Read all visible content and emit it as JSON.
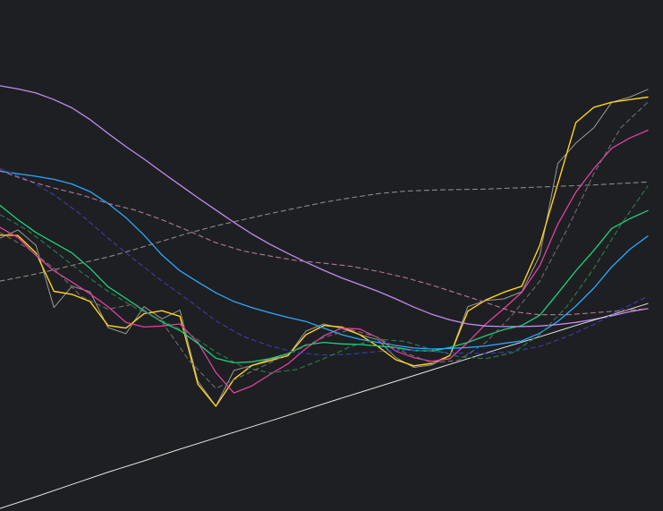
{
  "chart_data": {
    "type": "line",
    "title": "",
    "xlabel": "",
    "ylabel": "",
    "grid": false,
    "legend": "none",
    "xlim": [
      0,
      72
    ],
    "ylim": [
      0,
      100
    ],
    "background": "#1e1f22",
    "series": [
      {
        "color": "#9a9a9a",
        "dash": false,
        "width": 1,
        "x": [
          0,
          2,
          4,
          6,
          8,
          10,
          12,
          14,
          16,
          18,
          20,
          22,
          24,
          26,
          28,
          30,
          32,
          34,
          36,
          38,
          40,
          42,
          44,
          46,
          48,
          50,
          52,
          54,
          56,
          58,
          60,
          62,
          64,
          66,
          68,
          70,
          72
        ],
        "values": [
          53.4,
          55.0,
          52.0,
          39.8,
          44.0,
          42.9,
          35.9,
          34.7,
          40.0,
          37.6,
          39.3,
          25.4,
          20.5,
          27.5,
          28.5,
          29.7,
          30.4,
          35.2,
          36.6,
          35.7,
          34.5,
          33.5,
          30.0,
          28.1,
          28.6,
          30.4,
          40.0,
          41.2,
          41.5,
          42.9,
          50.0,
          68.0,
          72.0,
          75.0,
          80.0,
          81.0,
          82.5
        ]
      },
      {
        "color": "#ffd21f",
        "dash": false,
        "width": 1.4,
        "x": [
          0,
          2,
          4,
          6,
          8,
          10,
          12,
          14,
          16,
          18,
          20,
          22,
          24,
          26,
          28,
          30,
          32,
          34,
          36,
          38,
          40,
          42,
          44,
          46,
          48,
          50,
          52,
          54,
          56,
          58,
          60,
          62,
          64,
          66,
          68,
          70,
          72
        ],
        "values": [
          54.0,
          53.9,
          50.5,
          43.0,
          42.4,
          41.0,
          36.3,
          35.8,
          38.6,
          39.2,
          38.1,
          24.8,
          20.5,
          25.8,
          28.5,
          29.4,
          30.4,
          34.5,
          36.3,
          36.0,
          34.5,
          32.2,
          29.6,
          28.4,
          28.9,
          30.4,
          39.1,
          41.3,
          42.8,
          44.0,
          52.0,
          64.0,
          76.0,
          79.0,
          80.0,
          80.5,
          81.0
        ]
      },
      {
        "color": "#e040a0",
        "dash": false,
        "width": 1.3,
        "x": [
          0,
          2,
          4,
          6,
          8,
          10,
          12,
          14,
          16,
          18,
          20,
          22,
          24,
          26,
          28,
          30,
          32,
          34,
          36,
          38,
          40,
          42,
          44,
          46,
          48,
          50,
          52,
          54,
          56,
          58,
          60,
          62,
          64,
          66,
          68,
          70,
          72
        ],
        "values": [
          55.5,
          53.5,
          50.0,
          47.0,
          44.8,
          42.5,
          40.0,
          36.9,
          36.0,
          36.2,
          36.6,
          33.0,
          27.1,
          23.1,
          24.5,
          26.7,
          28.8,
          31.8,
          34.3,
          35.8,
          35.6,
          33.9,
          31.3,
          30.0,
          29.3,
          29.8,
          33.0,
          36.6,
          39.6,
          42.8,
          48.0,
          56.1,
          62.4,
          67.0,
          71.0,
          73.0,
          74.5
        ]
      },
      {
        "color": "#20d07a",
        "dash": false,
        "width": 1.3,
        "x": [
          0,
          2,
          4,
          6,
          8,
          10,
          12,
          14,
          16,
          18,
          20,
          22,
          24,
          26,
          28,
          30,
          32,
          34,
          36,
          38,
          40,
          42,
          44,
          46,
          48,
          50,
          52,
          54,
          56,
          58,
          60,
          62,
          64,
          66,
          68,
          70,
          72
        ],
        "values": [
          59.8,
          57.0,
          54.5,
          52.5,
          50.5,
          47.5,
          43.9,
          41.6,
          39.2,
          37.0,
          35.3,
          32.8,
          29.9,
          29.0,
          29.2,
          29.8,
          30.8,
          32.5,
          33.0,
          32.7,
          32.6,
          32.3,
          32.0,
          31.4,
          31.3,
          32.0,
          33.0,
          34.3,
          35.5,
          36.3,
          38.3,
          42.6,
          47.0,
          51.0,
          55.3,
          57.2,
          58.8
        ]
      },
      {
        "color": "#2aa8ff",
        "dash": false,
        "width": 1.3,
        "x": [
          0,
          2,
          4,
          6,
          8,
          10,
          12,
          14,
          16,
          18,
          20,
          22,
          24,
          26,
          28,
          30,
          32,
          34,
          36,
          38,
          40,
          42,
          44,
          46,
          48,
          50,
          52,
          54,
          56,
          58,
          60,
          62,
          64,
          66,
          68,
          70,
          72
        ],
        "values": [
          66.5,
          66.0,
          65.5,
          64.9,
          64.0,
          62.5,
          60.2,
          57.4,
          54.0,
          50.1,
          47.0,
          44.8,
          42.7,
          41.0,
          39.8,
          38.8,
          37.9,
          37.1,
          35.8,
          34.5,
          33.6,
          33.0,
          32.4,
          31.9,
          31.7,
          31.8,
          32.0,
          32.3,
          32.8,
          33.3,
          34.8,
          37.1,
          40.1,
          43.6,
          47.8,
          51.2,
          53.8
        ]
      },
      {
        "color": "#c38bf0",
        "dash": false,
        "width": 1.3,
        "x": [
          0,
          2,
          4,
          6,
          8,
          10,
          12,
          14,
          16,
          18,
          20,
          22,
          24,
          26,
          28,
          30,
          32,
          34,
          36,
          38,
          40,
          42,
          44,
          46,
          48,
          50,
          52,
          54,
          56,
          58,
          60,
          62,
          64,
          66,
          68,
          70,
          72
        ],
        "values": [
          83.2,
          82.6,
          81.8,
          80.5,
          78.9,
          76.6,
          73.9,
          71.3,
          68.9,
          66.3,
          63.8,
          61.3,
          58.9,
          56.5,
          54.2,
          52.2,
          50.4,
          48.7,
          47.1,
          45.6,
          44.3,
          43.0,
          41.5,
          39.9,
          38.5,
          37.4,
          36.6,
          36.2,
          36.1,
          36.1,
          36.2,
          36.5,
          36.9,
          37.5,
          38.2,
          39.0,
          39.6
        ]
      },
      {
        "color": "#e6e6e6",
        "dash": false,
        "width": 1,
        "x": [
          0,
          4,
          8,
          12,
          16,
          20,
          24,
          28,
          32,
          36,
          40,
          44,
          48,
          52,
          56,
          60,
          64,
          68,
          72
        ],
        "values": [
          0.5,
          2.8,
          5.2,
          7.6,
          9.8,
          12.1,
          14.3,
          16.5,
          18.7,
          21.0,
          23.2,
          25.4,
          27.6,
          29.8,
          32.0,
          34.1,
          36.3,
          38.4,
          40.6
        ]
      },
      {
        "color": "#3b3fa8",
        "dash": true,
        "width": 1.1,
        "x": [
          0,
          3,
          6,
          9,
          12,
          15,
          18,
          21,
          24,
          27,
          30,
          33,
          36,
          39,
          42,
          45,
          48,
          51,
          54,
          57,
          60,
          63,
          66,
          69,
          72
        ],
        "values": [
          67.0,
          64.9,
          61.9,
          58.0,
          53.4,
          49.1,
          45.0,
          41.2,
          37.2,
          34.2,
          32.3,
          31.0,
          30.5,
          30.7,
          31.2,
          31.5,
          31.2,
          30.9,
          30.8,
          31.2,
          32.2,
          34.1,
          36.5,
          39.4,
          42.0
        ]
      },
      {
        "color": "#b07a95",
        "dash": true,
        "width": 1.1,
        "x": [
          0,
          3,
          6,
          9,
          12,
          15,
          18,
          21,
          24,
          27,
          30,
          33,
          36,
          39,
          42,
          45,
          48,
          51,
          54,
          57,
          60,
          63,
          66,
          69,
          72
        ],
        "values": [
          66.6,
          64.7,
          63.2,
          61.9,
          60.2,
          58.9,
          57.0,
          54.8,
          52.5,
          50.9,
          49.9,
          49.0,
          48.5,
          47.9,
          46.9,
          45.7,
          44.2,
          42.5,
          40.8,
          39.0,
          38.4,
          38.4,
          38.8,
          39.2,
          39.6
        ]
      },
      {
        "color": "#8a8a8a",
        "dash": true,
        "width": 1.1,
        "x": [
          0,
          3,
          6,
          9,
          12,
          15,
          18,
          21,
          24,
          27,
          30,
          33,
          36,
          39,
          42,
          45,
          48,
          51,
          54,
          57,
          60,
          63,
          66,
          69,
          72
        ],
        "values": [
          45.0,
          46.0,
          47.2,
          48.5,
          49.7,
          51.2,
          52.8,
          54.4,
          55.8,
          57.0,
          58.2,
          59.3,
          60.4,
          61.3,
          62.1,
          62.6,
          62.8,
          62.9,
          63.0,
          63.2,
          63.4,
          63.6,
          63.8,
          64.1,
          64.4
        ]
      },
      {
        "color": "#2e7d4f",
        "dash": true,
        "width": 1.1,
        "x": [
          0,
          3,
          6,
          9,
          12,
          15,
          18,
          21,
          24,
          27,
          30,
          33,
          36,
          39,
          42,
          45,
          48,
          51,
          54,
          57,
          60,
          63,
          66,
          69,
          72
        ],
        "values": [
          58.0,
          55.0,
          51.0,
          46.8,
          43.0,
          39.8,
          37.3,
          34.7,
          31.1,
          28.2,
          27.0,
          27.7,
          29.8,
          32.2,
          33.6,
          33.2,
          31.6,
          30.2,
          29.8,
          31.0,
          34.5,
          40.0,
          47.5,
          56.0,
          63.6
        ]
      },
      {
        "color": "#6e6e6e",
        "dash": true,
        "width": 1.1,
        "x": [
          0,
          3,
          6,
          9,
          12,
          15,
          18,
          21,
          24,
          27,
          30,
          33,
          36,
          39,
          42,
          45,
          48,
          51,
          54,
          57,
          60,
          63,
          66,
          69,
          72
        ],
        "values": [
          54.5,
          51.5,
          47.5,
          42.0,
          39.5,
          40.5,
          37.0,
          29.5,
          24.0,
          26.5,
          29.0,
          31.5,
          34.0,
          35.5,
          34.0,
          31.0,
          29.0,
          29.5,
          33.0,
          38.5,
          45.0,
          55.0,
          66.0,
          75.0,
          80.0
        ]
      }
    ]
  }
}
